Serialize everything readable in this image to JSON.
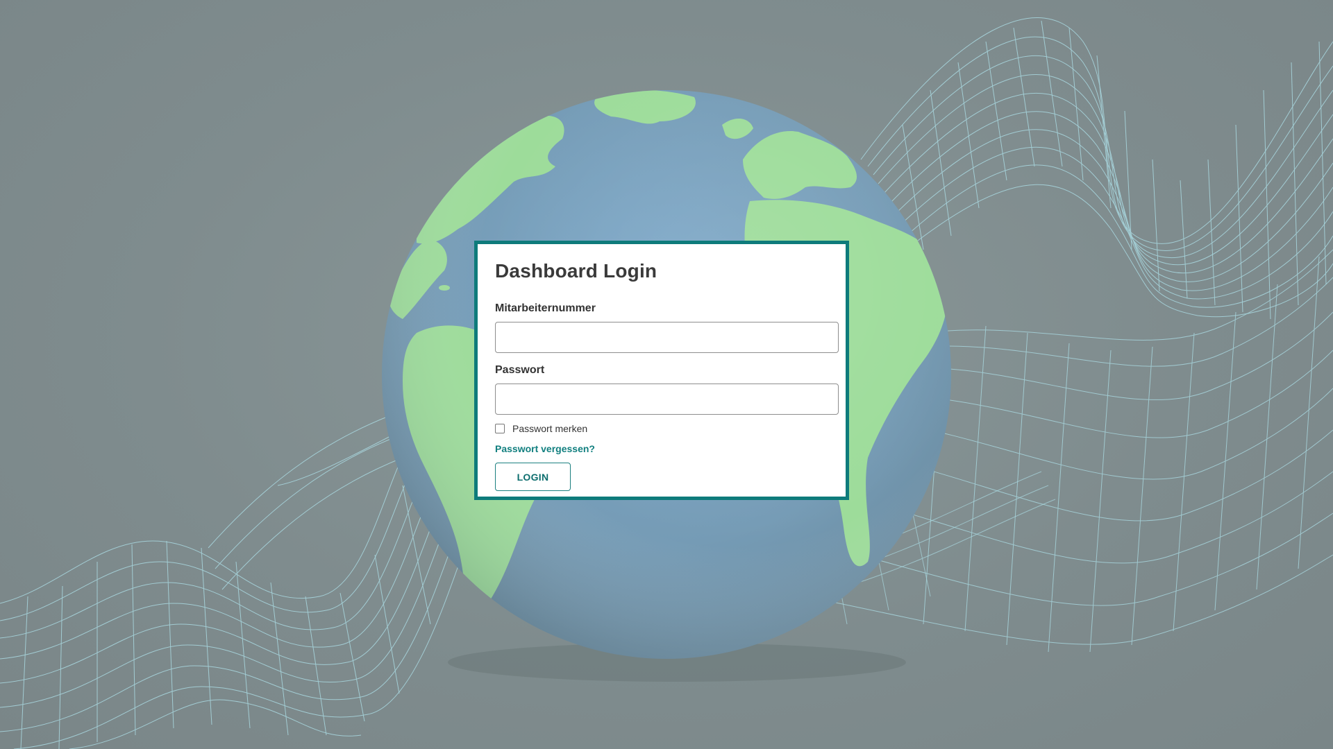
{
  "login": {
    "title": "Dashboard Login",
    "employee_number_label": "Mitarbeiternummer",
    "employee_number_value": "",
    "password_label": "Passwort",
    "password_value": "",
    "remember_label": "Passwort merken",
    "remember_checked": false,
    "forgot_link": "Passwort vergessen?",
    "login_button": "LOGIN"
  },
  "colors": {
    "background": "#7f8c8e",
    "accent": "#0e7b7b",
    "ocean": "#7aa2bd",
    "land": "#9ddc9a",
    "wireframe": "#a9d8e0"
  },
  "icons": {
    "checkbox": "checkbox-unchecked-icon"
  }
}
